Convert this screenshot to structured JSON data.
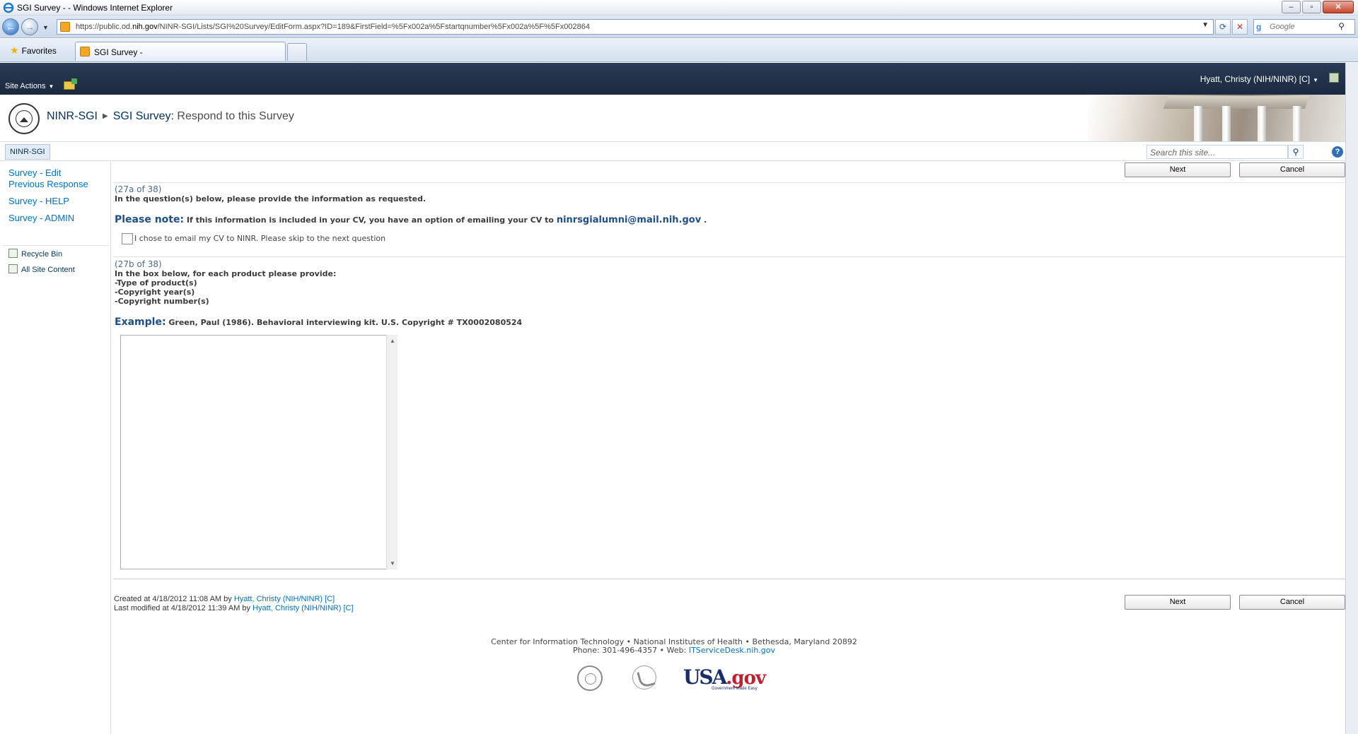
{
  "browser": {
    "window_title": "SGI Survey - - Windows Internet Explorer",
    "url_prefix": "https://public.od.",
    "url_host": "nih.gov",
    "url_rest": "/NINR-SGI/Lists/SGI%20Survey/EditForm.aspx?ID=189&FirstField=%5Fx002a%5Fstartqnumber%5Fx002a%5F%5Fx002864",
    "search_placeholder": "Google",
    "favorites_label": "Favorites",
    "tab_title": "SGI Survey -"
  },
  "sharepoint": {
    "site_actions": "Site Actions",
    "user_name": "Hyatt, Christy (NIH/NINR) [C]",
    "breadcrumb": {
      "site": "NINR-SGI",
      "list": "SGI Survey",
      "separator_colon": ":",
      "page": "Respond to this Survey"
    },
    "top_nav_tab": "NINR-SGI",
    "site_search_placeholder": "Search this site..."
  },
  "left_nav": {
    "links": [
      "Survey - Edit Previous Response",
      "Survey - HELP",
      "Survey - ADMIN"
    ],
    "link_1a": "Survey - Edit",
    "link_1b": "Previous Response",
    "recycle_bin": "Recycle Bin",
    "all_site_content": "All Site Content"
  },
  "form": {
    "next_label": "Next",
    "cancel_label": "Cancel",
    "q27a": {
      "number": "(27a of 38)",
      "instruction": "In the question(s) below, please provide the information as requested.",
      "note_label": "Please note:",
      "note_text": "If this information is included in your CV, you have an option of emailing your CV to",
      "email": "ninrsgialumni@mail.nih.gov",
      "note_end": ".",
      "checkbox_label": "I chose to email my CV to NINR. Please skip to the next question",
      "checkbox_checked": false
    },
    "q27b": {
      "number": "(27b of 38)",
      "line1": "In the box below, for each product please provide:",
      "line2": "-Type of product(s)",
      "line3": "-Copyright year(s)",
      "line4": "-Copyright number(s)",
      "example_label": "Example:",
      "example_text": "Green, Paul (1986). Behavioral interviewing kit. U.S. Copyright # TX0002080524",
      "answer_value": ""
    },
    "created_prefix": "Created at 4/18/2012 11:08 AM by",
    "created_by": "Hyatt, Christy (NIH/NINR) [C]",
    "modified_prefix": "Last modified at 4/18/2012 11:39 AM by",
    "modified_by": "Hyatt, Christy (NIH/NINR) [C]"
  },
  "footer": {
    "line1": "Center for Information Technology • National Institutes of Health • Bethesda, Maryland 20892",
    "line2_prefix": "Phone: 301-496-4357 • Web:",
    "line2_link": "ITServiceDesk.nih.gov",
    "usa_logo_main": "USA",
    "usa_logo_gov": ".gov",
    "usa_logo_tagline": "Government Made Easy"
  },
  "icons": [
    "ie-logo-icon",
    "back-arrow-icon",
    "forward-arrow-icon",
    "page-icon",
    "refresh-icon",
    "stop-icon",
    "google-icon",
    "search-icon",
    "favorites-star-icon",
    "folder-icon",
    "user-icon",
    "nih-seal-icon",
    "help-icon",
    "recycle-bin-icon",
    "all-site-content-icon",
    "hhs-logo-icon"
  ]
}
